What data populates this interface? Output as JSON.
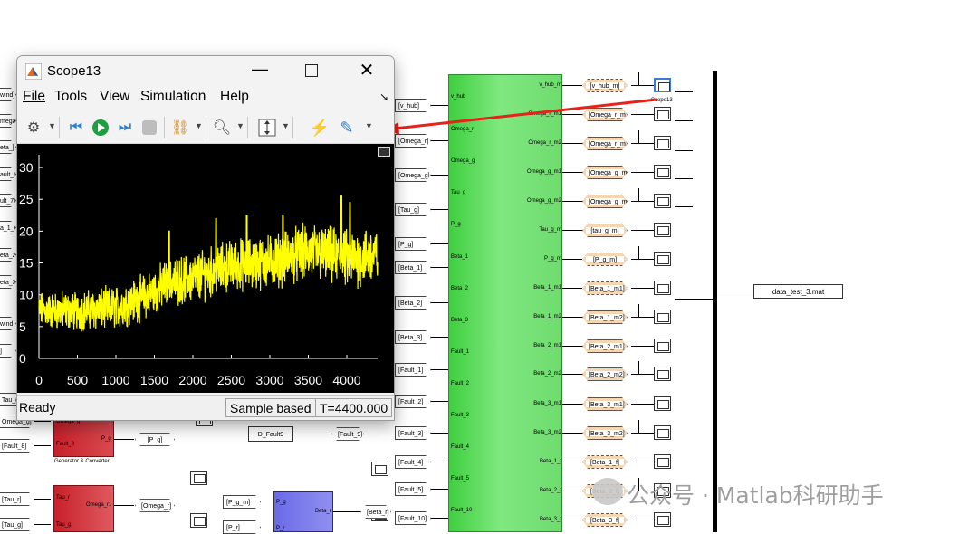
{
  "scope_window": {
    "title": "Scope13",
    "menu": [
      "File",
      "Tools",
      "View",
      "Simulation",
      "Help"
    ],
    "status": {
      "ready": "Ready",
      "mode": "Sample based",
      "time": "T=4400.000"
    }
  },
  "toolbar_icons": [
    "gear-icon",
    "step-back-icon",
    "run-icon",
    "step-forward-icon",
    "stop-icon",
    "signal-select-icon",
    "zoom-icon",
    "autoscale-icon",
    "highlight-simulink-icon",
    "edit-icon"
  ],
  "chart_data": {
    "type": "line",
    "xlim": [
      0,
      4400
    ],
    "ylim": [
      0,
      32
    ],
    "xticks": [
      0,
      500,
      1000,
      1500,
      2000,
      2500,
      3000,
      3500,
      4000
    ],
    "yticks": [
      0,
      5,
      10,
      15,
      20,
      25,
      30
    ],
    "series_color": "#ffff00",
    "background": "#000000",
    "trend": [
      [
        0,
        7.6
      ],
      [
        500,
        7.4
      ],
      [
        1000,
        8.0
      ],
      [
        1400,
        9.8
      ],
      [
        1700,
        12.0
      ],
      [
        2000,
        12.6
      ],
      [
        2500,
        14.6
      ],
      [
        3000,
        15.2
      ],
      [
        3500,
        16.8
      ],
      [
        4000,
        15.6
      ],
      [
        4400,
        16.2
      ]
    ],
    "noise_amplitude": [
      [
        0,
        2.2
      ],
      [
        2000,
        3.0
      ],
      [
        4400,
        3.6
      ]
    ],
    "peaks": [
      [
        1690,
        20.0
      ],
      [
        2300,
        22.0
      ],
      [
        2700,
        22.5
      ],
      [
        3170,
        22.5
      ],
      [
        3930,
        25.5
      ],
      [
        4040,
        24.5
      ]
    ]
  },
  "canvas": {
    "left_tags": [
      "wind]",
      "mega_",
      "eta_]",
      "ault_6]",
      "ult_7]",
      "a_1_(",
      "eta_2_",
      "eta_3_",
      "wind",
      "]",
      "Tau_g",
      "Omega_g]",
      "[Fault_8]",
      "[Tau_r]",
      "[Tau_g]"
    ],
    "mux_inputs": [
      "[v_hub]",
      "[Omega_r]",
      "[Omega_g]",
      "[Tau_g]",
      "[P_g]",
      "[Beta_1]",
      "[Beta_2]",
      "[Beta_3]",
      "[Fault_1]",
      "[Fault_2]",
      "[Fault_3]",
      "[Fault_4]",
      "[Fault_5]",
      "[Fault_10]"
    ],
    "green_in_ports": [
      "v_hub",
      "Omega_r",
      "Omega_g",
      "Tau_g",
      "P_g",
      "Beta_1",
      "Beta_2",
      "Beta_3",
      "Fault_1",
      "Fault_2",
      "Fault_3",
      "Fault_4",
      "Fault_5",
      "Fault_10"
    ],
    "green_out_ports": [
      "v_hub_m",
      "Omega_r_m1",
      "Omega_r_m2",
      "Omega_g_m1",
      "Omega_g_m2",
      "Tau_g_m",
      "P_g_m",
      "Beta_1_m1",
      "Beta_1_m2",
      "Beta_2_m1",
      "Beta_2_m2",
      "Beta_3_m1",
      "Beta_3_m2",
      "Beta_1_f",
      "Beta_2_f",
      "Beta_3_f"
    ],
    "goto_tags": [
      "[v_hub_m]",
      "[Omega_r_m1]",
      "[Omega_r_m2]",
      "[Omega_g_m1]",
      "[Omega_g_m2]",
      "[tau_g_m]",
      "[P_g_m]",
      "[Beta_1_m1]",
      "[Beta_1_m2]",
      "[Beta_2_m1]",
      "[Beta_2_m2]",
      "[Beta_3_m1]",
      "[Beta_3_m2]",
      "[Beta_1_f]",
      "[Beta_2_f]",
      "[Beta_3_f]"
    ],
    "scope_label": "Scope13",
    "to_file": "data_test_3.mat",
    "gen_block": {
      "in1": "Omega_g",
      "in2": "Fault_8",
      "out": "P_g",
      "label": "Generator & Converter"
    },
    "gen_out_tag": "[P_g]",
    "dfault_block": "D_Fault9",
    "dfault_tag": "[Fault_9]",
    "red2_block": {
      "in1": "Tau_r",
      "in2": "Tau_g",
      "out": "Omega_r1"
    },
    "red2_out_tag": "[Omega_r]",
    "blue_block": {
      "in1": "P_g",
      "in2": "P_r",
      "out": "Beta_r"
    },
    "blue_in_tags": [
      "[P_g_m]",
      "[P_r]"
    ],
    "blue_out_tag": "[Beta_r]",
    "watermark": "公众号 · Matlab科研助手"
  }
}
